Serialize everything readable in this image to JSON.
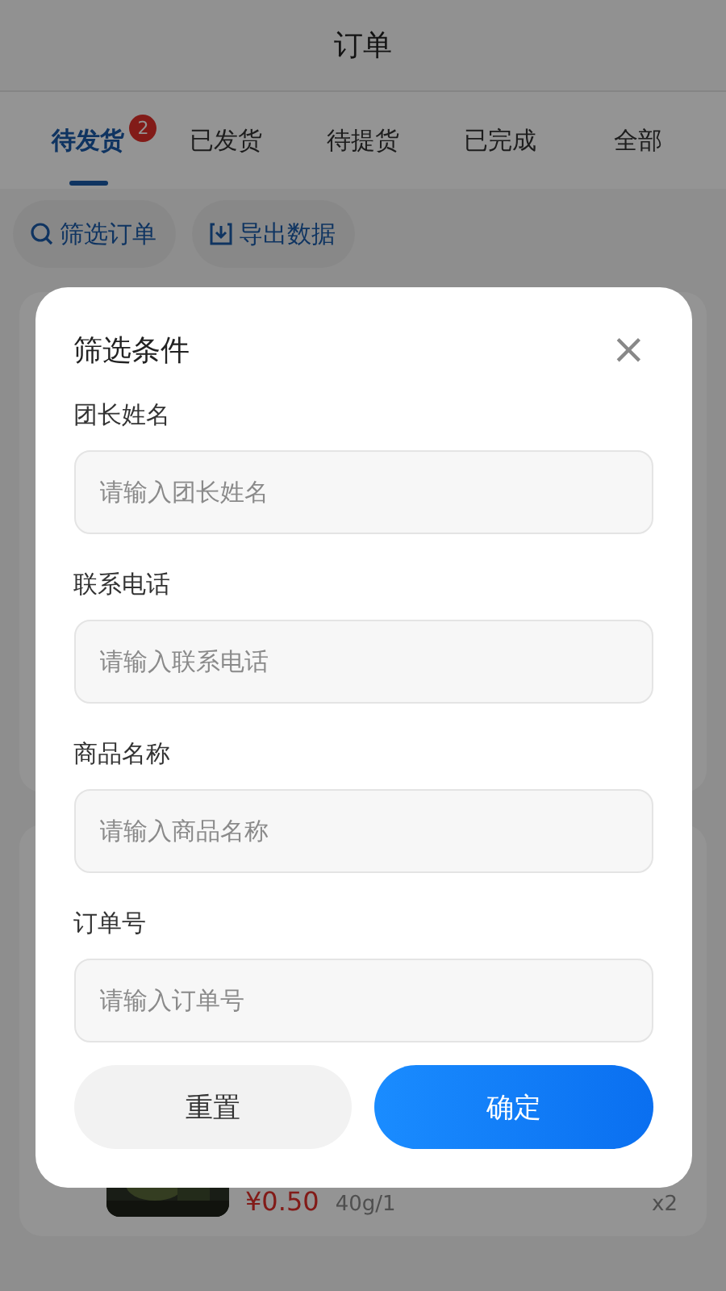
{
  "header": {
    "title": "订单"
  },
  "tabs": [
    {
      "label": "待发货",
      "selected": true,
      "badge": "2"
    },
    {
      "label": "已发货",
      "selected": false
    },
    {
      "label": "待提货",
      "selected": false
    },
    {
      "label": "已完成",
      "selected": false
    },
    {
      "label": "全部",
      "selected": false
    }
  ],
  "actions": [
    {
      "label": "筛选订单",
      "kind": "search"
    },
    {
      "label": "导出数据",
      "kind": "export"
    }
  ],
  "order_item": {
    "price": "¥0.50",
    "spec": "40g/1",
    "quantity": "x2"
  },
  "filter_dialog": {
    "title": "筛选条件",
    "close": "×",
    "fields": [
      {
        "label": "团长姓名",
        "placeholder": "请输入团长姓名"
      },
      {
        "label": "联系电话",
        "placeholder": "请输入联系电话"
      },
      {
        "label": "商品名称",
        "placeholder": "请输入商品名称"
      },
      {
        "label": "订单号",
        "placeholder": "请输入订单号"
      }
    ],
    "buttons": [
      {
        "label": "重置",
        "kind": "secondary"
      },
      {
        "label": "确定",
        "kind": "primary"
      }
    ]
  }
}
